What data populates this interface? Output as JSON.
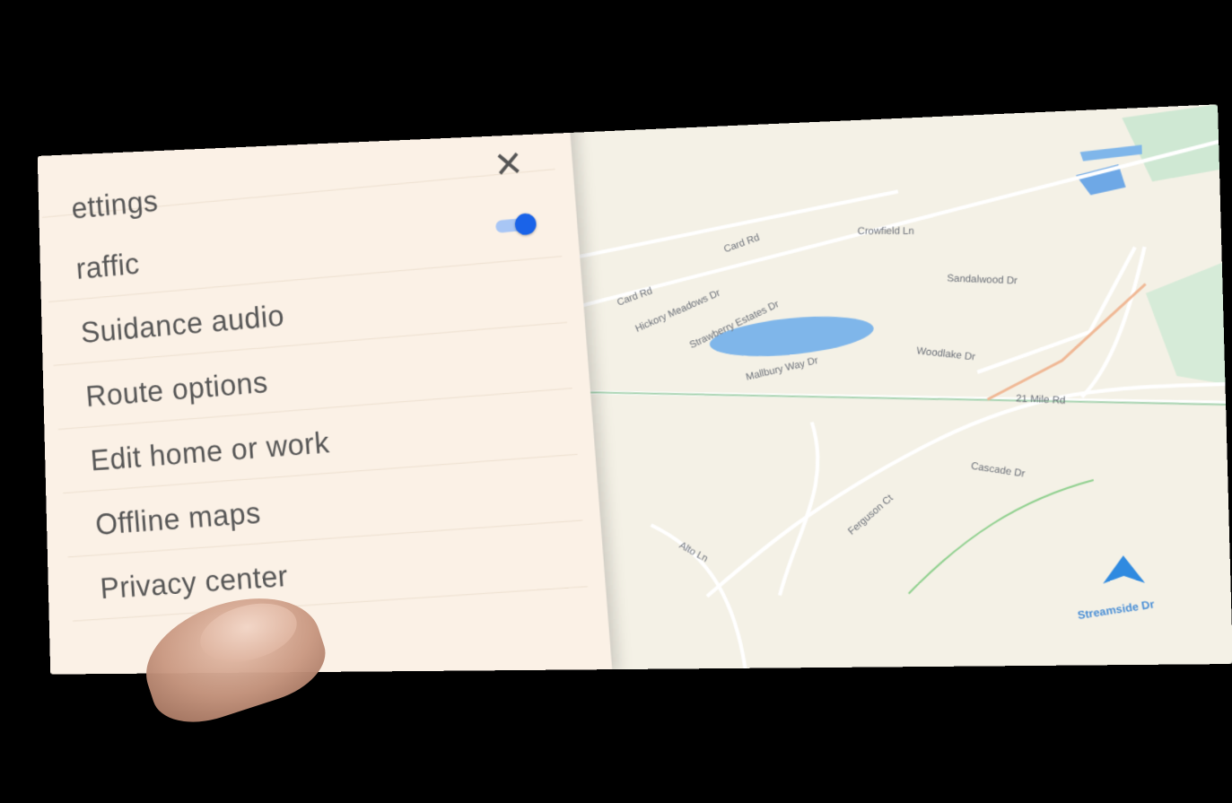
{
  "settings": {
    "title": "ettings",
    "close_icon": "close-icon",
    "items": [
      {
        "label": "raffic",
        "toggle": true
      },
      {
        "label": "Suidance audio"
      },
      {
        "label": "Route options"
      },
      {
        "label": "Edit home or work"
      },
      {
        "label": "Offline maps"
      },
      {
        "label": "Privacy center"
      }
    ],
    "toggle_color": "#1a63e8"
  },
  "map": {
    "streets": [
      "Card Rd",
      "Card Rd",
      "Hickory Meadows Dr",
      "Strawberry Estates Dr",
      "Mallbury Way Dr",
      "Woodlake Dr",
      "Crowfield Ln",
      "Sandalwood Dr",
      "21 Mile Rd",
      "Cascade Dr",
      "Ferguson Ct",
      "Alto Ln",
      "Streamside Dr"
    ],
    "water_color": "#7fb6ea",
    "land_color": "#f4f1e6",
    "park_color": "#cfe8d3",
    "nav_arrow_color": "#2f8ae0"
  }
}
